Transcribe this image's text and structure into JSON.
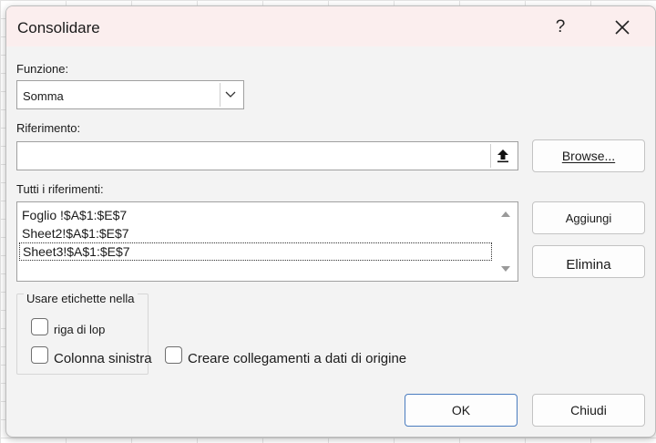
{
  "dialog": {
    "title": "Consolidare",
    "help_label": "?"
  },
  "function": {
    "label": "Funzione:",
    "selected": "Somma"
  },
  "reference": {
    "label": "Riferimento:",
    "value": "",
    "browse_label": "Browse..."
  },
  "all_references": {
    "label": "Tutti i riferimenti:",
    "items": [
      "Foglio  !$A$1:$E$7",
      "Sheet2!$A$1:$E$7",
      "Sheet3!$A$1:$E$7"
    ],
    "add_label": "Aggiungi",
    "delete_label": "Elimina"
  },
  "labels_group": {
    "title": "Usare etichette nella",
    "top_row": {
      "label": "riga di lop",
      "checked": false
    },
    "left_column": {
      "label": "Colonna sinistra",
      "checked": false
    },
    "create_links": {
      "label": "Creare collegamenti a dati di origine",
      "checked": false
    }
  },
  "footer": {
    "ok_label": "OK",
    "close_label": "Chiudi"
  },
  "icons": {
    "help": "question-mark-icon",
    "close": "close-icon",
    "dropdown": "chevron-down-icon",
    "collapse": "up-arrow-icon",
    "scroll_up": "triangle-up-icon",
    "scroll_down": "triangle-down-icon"
  },
  "colors": {
    "title_bar": "#fbeeee",
    "dialog_bg": "#f3f3f3",
    "primary_border": "#4a7cbf"
  }
}
